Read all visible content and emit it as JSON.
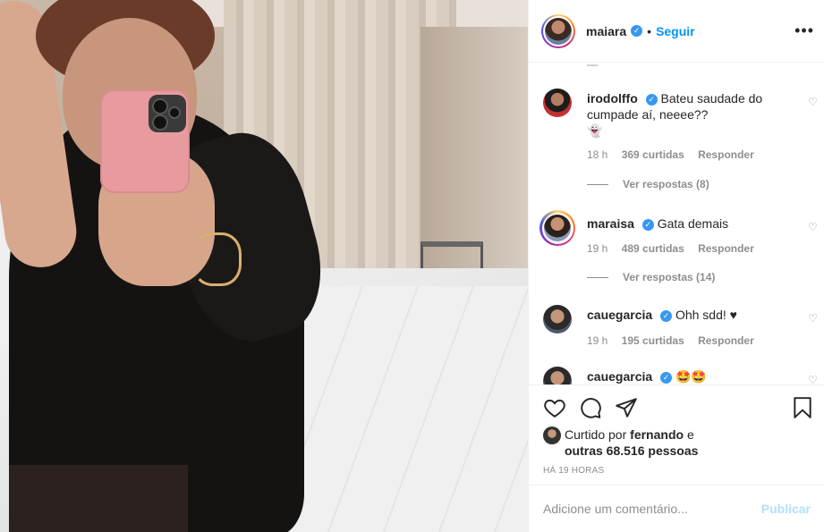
{
  "post": {
    "image_alt": "",
    "username": "maiara",
    "verified_icon": "verified-badge-icon",
    "separator": "•",
    "follow_label": "Seguir",
    "more_icon": "more-options-icon",
    "more_glyph": "•••"
  },
  "comments": [
    {
      "username": "irodolffo",
      "text": "Bateu saudade do cumpade aí, neeee??",
      "emoji": "👻",
      "time": "18 h",
      "likes": "369 curtidas",
      "reply": "Responder",
      "view_replies": "Ver respostas (8)"
    },
    {
      "username": "maraisa",
      "text": "Gata demais",
      "time": "19 h",
      "likes": "489 curtidas",
      "reply": "Responder",
      "view_replies": "Ver respostas (14)"
    },
    {
      "username": "cauegarcia",
      "text": "Ohh sdd! ♥",
      "time": "19 h",
      "likes": "195 curtidas",
      "reply": "Responder"
    },
    {
      "username": "cauegarcia",
      "text": "🤩🤩"
    }
  ],
  "actions": {
    "like_icon": "heart-icon",
    "comment_icon": "comment-icon",
    "share_icon": "share-icon",
    "save_icon": "bookmark-icon"
  },
  "likes": {
    "prefix": "Curtido por",
    "user": "fernando",
    "joiner": "e",
    "others": "outras 68.516 pessoas"
  },
  "timestamp": "HÁ 19 HORAS",
  "comment_box": {
    "placeholder": "Adicione um comentário...",
    "publish_label": "Publicar"
  },
  "colors": {
    "accent": "#0095f6",
    "publish_disabled": "#b2dffc",
    "muted": "#8e8e8e",
    "text": "#262626"
  }
}
